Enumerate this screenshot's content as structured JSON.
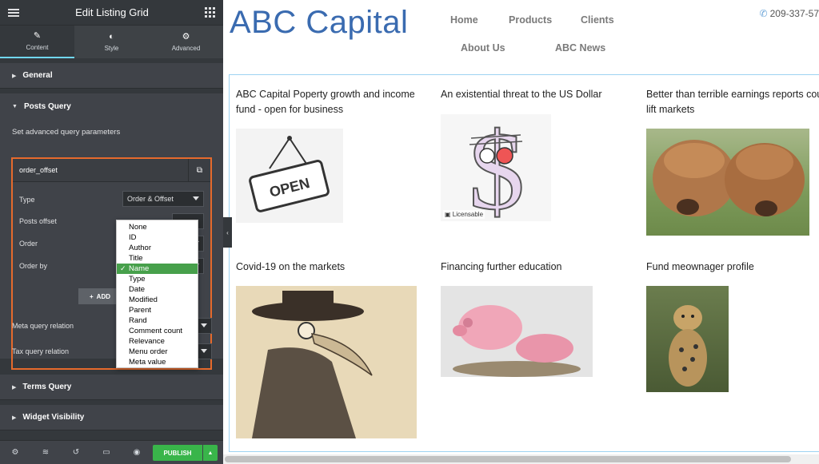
{
  "panel": {
    "title": "Edit Listing Grid",
    "tabs": [
      {
        "label": "Content",
        "icon": "pencil-icon"
      },
      {
        "label": "Style",
        "icon": "contrast-icon"
      },
      {
        "label": "Advanced",
        "icon": "gear-icon"
      }
    ],
    "sections": {
      "general": "General",
      "posts_query": "Posts Query",
      "terms_query": "Terms Query",
      "widget_visibility": "Widget Visibility"
    },
    "advanced_note": "Set advanced query parameters",
    "repeater": {
      "item_title": "order_offset",
      "type_label": "Type",
      "type_value": "Order & Offset",
      "posts_offset_label": "Posts offset",
      "order_label": "Order",
      "order_by_label": "Order by",
      "add_label": "ADD"
    },
    "meta_query_relation": "Meta query relation",
    "tax_query_relation": "Tax query relation",
    "dropdown_options": [
      "None",
      "ID",
      "Author",
      "Title",
      "Name",
      "Type",
      "Date",
      "Modified",
      "Parent",
      "Rand",
      "Comment count",
      "Relevance",
      "Menu order",
      "Meta value"
    ],
    "dropdown_selected": "Name",
    "publish_label": "PUBLISH"
  },
  "site": {
    "logo": "ABC Capital",
    "nav": [
      "Home",
      "Products",
      "Clients",
      "About Us",
      "ABC News"
    ],
    "phone": "209-337-57",
    "cards": [
      {
        "title": "ABC Capital Poperty growth and income fund - open for business"
      },
      {
        "title": "An existential threat to the US Dollar",
        "badge": "Licensable"
      },
      {
        "title": "Better than terrible earnings reports could lift markets"
      },
      {
        "title": "Covid-19 on the markets"
      },
      {
        "title": "Financing further education"
      },
      {
        "title": "Fund meownager profile"
      }
    ]
  },
  "colors": {
    "accent_orange": "#e66a2c",
    "publish_green": "#39b54a",
    "logo_blue": "#3a6bb0",
    "tab_active": "#71d7f7"
  }
}
